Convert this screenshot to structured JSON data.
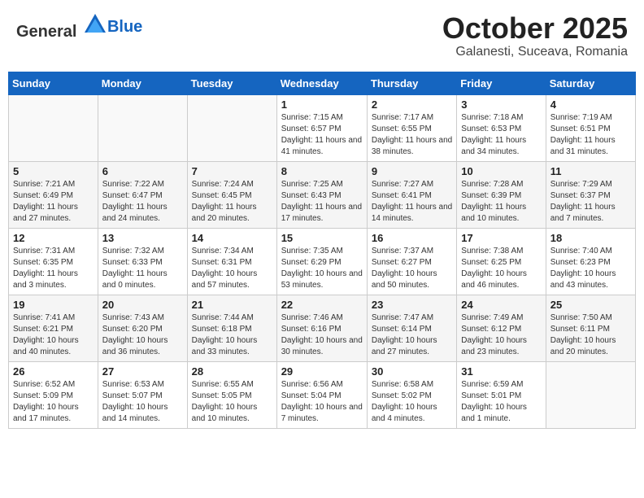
{
  "header": {
    "logo_general": "General",
    "logo_blue": "Blue",
    "month": "October 2025",
    "location": "Galanesti, Suceava, Romania"
  },
  "weekdays": [
    "Sunday",
    "Monday",
    "Tuesday",
    "Wednesday",
    "Thursday",
    "Friday",
    "Saturday"
  ],
  "weeks": [
    [
      {
        "day": "",
        "info": ""
      },
      {
        "day": "",
        "info": ""
      },
      {
        "day": "",
        "info": ""
      },
      {
        "day": "1",
        "info": "Sunrise: 7:15 AM\nSunset: 6:57 PM\nDaylight: 11 hours and 41 minutes."
      },
      {
        "day": "2",
        "info": "Sunrise: 7:17 AM\nSunset: 6:55 PM\nDaylight: 11 hours and 38 minutes."
      },
      {
        "day": "3",
        "info": "Sunrise: 7:18 AM\nSunset: 6:53 PM\nDaylight: 11 hours and 34 minutes."
      },
      {
        "day": "4",
        "info": "Sunrise: 7:19 AM\nSunset: 6:51 PM\nDaylight: 11 hours and 31 minutes."
      }
    ],
    [
      {
        "day": "5",
        "info": "Sunrise: 7:21 AM\nSunset: 6:49 PM\nDaylight: 11 hours and 27 minutes."
      },
      {
        "day": "6",
        "info": "Sunrise: 7:22 AM\nSunset: 6:47 PM\nDaylight: 11 hours and 24 minutes."
      },
      {
        "day": "7",
        "info": "Sunrise: 7:24 AM\nSunset: 6:45 PM\nDaylight: 11 hours and 20 minutes."
      },
      {
        "day": "8",
        "info": "Sunrise: 7:25 AM\nSunset: 6:43 PM\nDaylight: 11 hours and 17 minutes."
      },
      {
        "day": "9",
        "info": "Sunrise: 7:27 AM\nSunset: 6:41 PM\nDaylight: 11 hours and 14 minutes."
      },
      {
        "day": "10",
        "info": "Sunrise: 7:28 AM\nSunset: 6:39 PM\nDaylight: 11 hours and 10 minutes."
      },
      {
        "day": "11",
        "info": "Sunrise: 7:29 AM\nSunset: 6:37 PM\nDaylight: 11 hours and 7 minutes."
      }
    ],
    [
      {
        "day": "12",
        "info": "Sunrise: 7:31 AM\nSunset: 6:35 PM\nDaylight: 11 hours and 3 minutes."
      },
      {
        "day": "13",
        "info": "Sunrise: 7:32 AM\nSunset: 6:33 PM\nDaylight: 11 hours and 0 minutes."
      },
      {
        "day": "14",
        "info": "Sunrise: 7:34 AM\nSunset: 6:31 PM\nDaylight: 10 hours and 57 minutes."
      },
      {
        "day": "15",
        "info": "Sunrise: 7:35 AM\nSunset: 6:29 PM\nDaylight: 10 hours and 53 minutes."
      },
      {
        "day": "16",
        "info": "Sunrise: 7:37 AM\nSunset: 6:27 PM\nDaylight: 10 hours and 50 minutes."
      },
      {
        "day": "17",
        "info": "Sunrise: 7:38 AM\nSunset: 6:25 PM\nDaylight: 10 hours and 46 minutes."
      },
      {
        "day": "18",
        "info": "Sunrise: 7:40 AM\nSunset: 6:23 PM\nDaylight: 10 hours and 43 minutes."
      }
    ],
    [
      {
        "day": "19",
        "info": "Sunrise: 7:41 AM\nSunset: 6:21 PM\nDaylight: 10 hours and 40 minutes."
      },
      {
        "day": "20",
        "info": "Sunrise: 7:43 AM\nSunset: 6:20 PM\nDaylight: 10 hours and 36 minutes."
      },
      {
        "day": "21",
        "info": "Sunrise: 7:44 AM\nSunset: 6:18 PM\nDaylight: 10 hours and 33 minutes."
      },
      {
        "day": "22",
        "info": "Sunrise: 7:46 AM\nSunset: 6:16 PM\nDaylight: 10 hours and 30 minutes."
      },
      {
        "day": "23",
        "info": "Sunrise: 7:47 AM\nSunset: 6:14 PM\nDaylight: 10 hours and 27 minutes."
      },
      {
        "day": "24",
        "info": "Sunrise: 7:49 AM\nSunset: 6:12 PM\nDaylight: 10 hours and 23 minutes."
      },
      {
        "day": "25",
        "info": "Sunrise: 7:50 AM\nSunset: 6:11 PM\nDaylight: 10 hours and 20 minutes."
      }
    ],
    [
      {
        "day": "26",
        "info": "Sunrise: 6:52 AM\nSunset: 5:09 PM\nDaylight: 10 hours and 17 minutes."
      },
      {
        "day": "27",
        "info": "Sunrise: 6:53 AM\nSunset: 5:07 PM\nDaylight: 10 hours and 14 minutes."
      },
      {
        "day": "28",
        "info": "Sunrise: 6:55 AM\nSunset: 5:05 PM\nDaylight: 10 hours and 10 minutes."
      },
      {
        "day": "29",
        "info": "Sunrise: 6:56 AM\nSunset: 5:04 PM\nDaylight: 10 hours and 7 minutes."
      },
      {
        "day": "30",
        "info": "Sunrise: 6:58 AM\nSunset: 5:02 PM\nDaylight: 10 hours and 4 minutes."
      },
      {
        "day": "31",
        "info": "Sunrise: 6:59 AM\nSunset: 5:01 PM\nDaylight: 10 hours and 1 minute."
      },
      {
        "day": "",
        "info": ""
      }
    ]
  ]
}
